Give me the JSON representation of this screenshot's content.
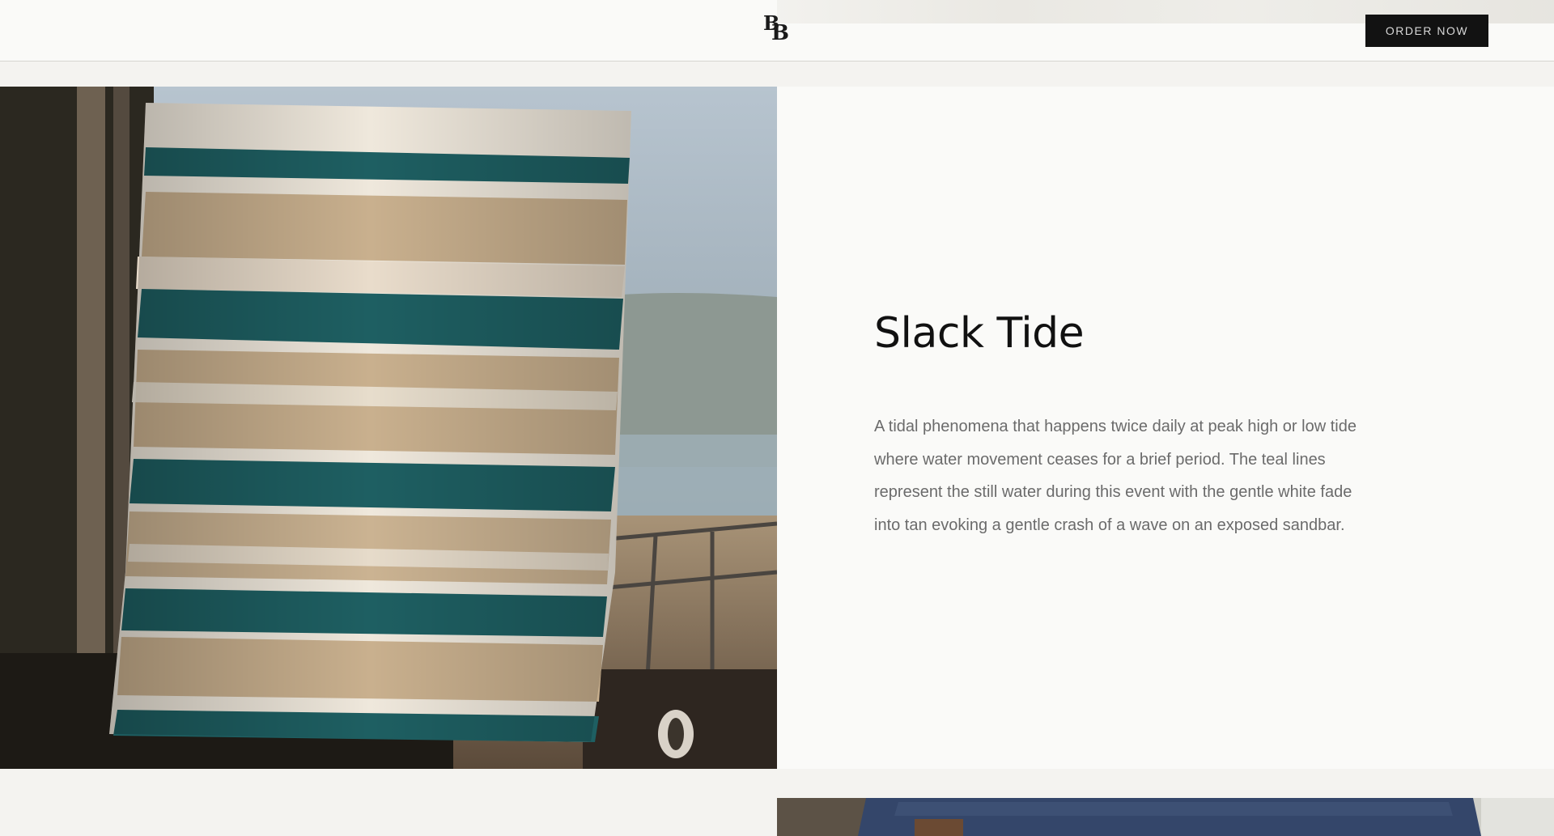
{
  "header": {
    "logo_text_1": "B",
    "logo_text_2": "B",
    "order_button_label": "ORDER NOW"
  },
  "feature": {
    "title": "Slack Tide",
    "description": "A tidal phenomena that happens twice daily at peak high or low tide where water movement ceases for a brief period. The teal lines represent the still water during this event with the gentle white fade into tan evoking a gentle crash of a wave on an exposed sandbar."
  },
  "colors": {
    "teal_stripe": "#1e5f62",
    "tan": "#c9b08e",
    "cream": "#efe8dc",
    "button_bg": "#121212"
  }
}
